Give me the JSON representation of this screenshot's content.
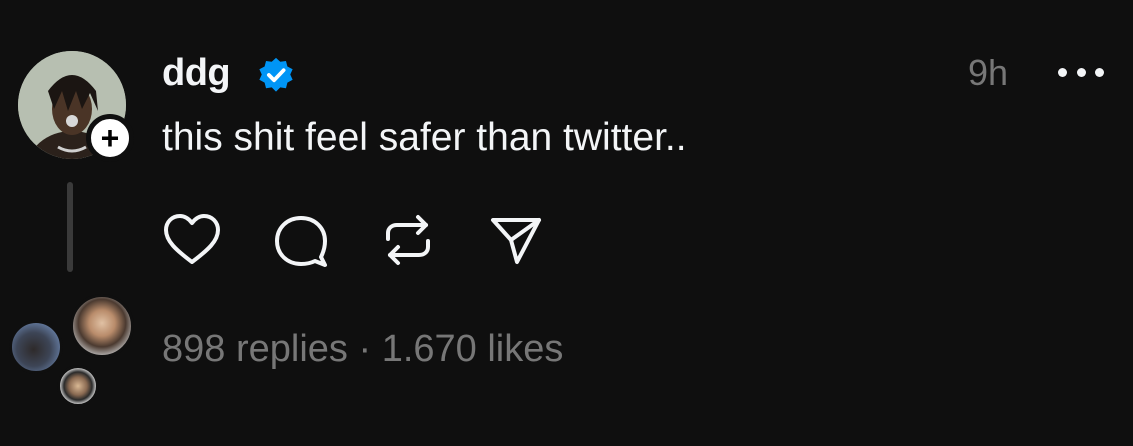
{
  "post": {
    "username": "ddg",
    "verified": true,
    "time": "9h",
    "text": "this shit feel safer than twitter..",
    "follow_symbol": "+",
    "replies": "898 replies",
    "separator": "·",
    "likes": "1.670 likes"
  },
  "icons": {
    "verified": "verified-badge-icon",
    "more": "more-options-icon",
    "like": "heart-icon",
    "reply": "comment-icon",
    "repost": "repost-icon",
    "share": "send-icon"
  },
  "colors": {
    "background": "#0f0f0f",
    "text": "#f3f5f7",
    "muted": "#777777",
    "verified": "#0095f6"
  }
}
